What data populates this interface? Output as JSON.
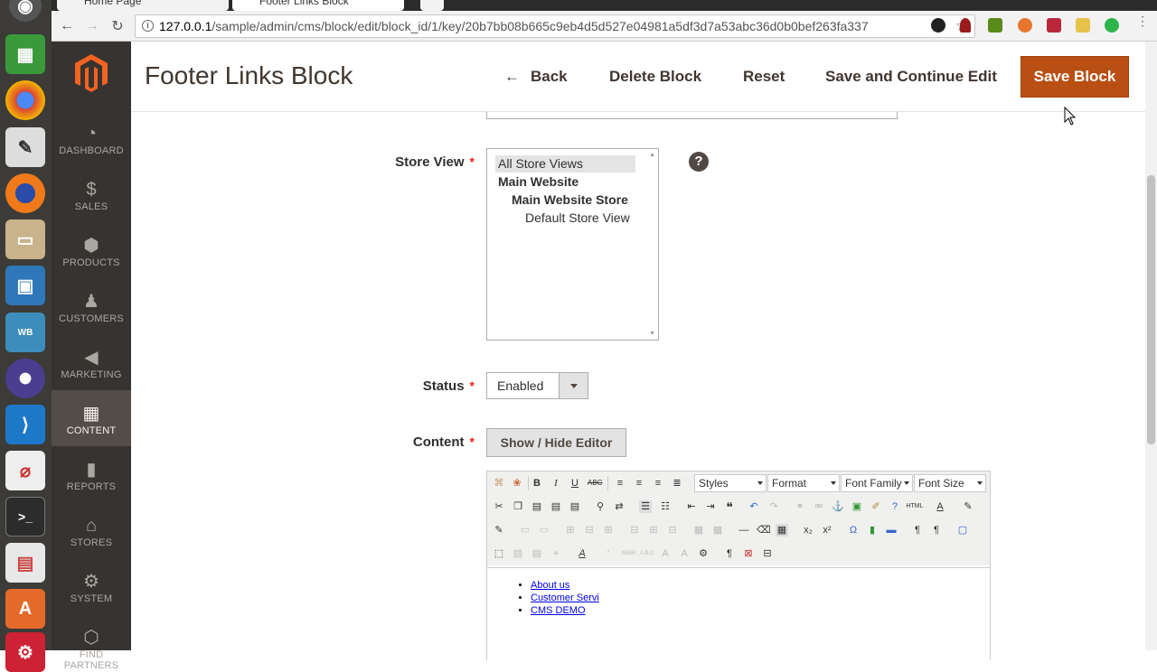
{
  "browser": {
    "tabs": [
      "Home Page",
      "Footer Links Block"
    ],
    "url_host": "127.0.0.1",
    "url_path": "/sample/admin/cms/block/edit/block_id/1/key/20b7bb08b665c9eb4d5d527e04981a5df3d7a53abc36d0b0bef263fa337",
    "nav": {
      "back": "←",
      "forward": "→",
      "reload": "↻",
      "star": "☆"
    }
  },
  "sidebar": {
    "items": [
      {
        "label": "DASHBOARD",
        "icon": "dashboard-icon"
      },
      {
        "label": "SALES",
        "icon": "dollar-icon"
      },
      {
        "label": "PRODUCTS",
        "icon": "cube-icon"
      },
      {
        "label": "CUSTOMERS",
        "icon": "person-icon"
      },
      {
        "label": "MARKETING",
        "icon": "megaphone-icon"
      },
      {
        "label": "CONTENT",
        "icon": "layout-icon",
        "active": true
      },
      {
        "label": "REPORTS",
        "icon": "bar-chart-icon"
      },
      {
        "label": "STORES",
        "icon": "store-icon"
      },
      {
        "label": "SYSTEM",
        "icon": "gear-icon"
      },
      {
        "label": "FIND PARTNERS",
        "icon": "box-icon"
      }
    ]
  },
  "header": {
    "title": "Footer Links Block",
    "back_arrow": "←",
    "back_label": "Back",
    "delete_label": "Delete Block",
    "reset_label": "Reset",
    "save_continue_label": "Save and Continue Edit",
    "save_label": "Save Block"
  },
  "form": {
    "store_view": {
      "label": "Store View",
      "required": "*",
      "options": [
        "All Store Views",
        "Main Website",
        "Main Website Store",
        "Default Store View"
      ],
      "help": "?"
    },
    "status": {
      "label": "Status",
      "required": "*",
      "value": "Enabled"
    },
    "content": {
      "label": "Content",
      "required": "*",
      "toggle_label": "Show / Hide Editor",
      "toolbar_dropdowns": [
        "Styles",
        "Format",
        "Font Family",
        "Font Size"
      ],
      "links": [
        "About us",
        "Customer Servi",
        "CMS DEMO"
      ]
    }
  },
  "colors": {
    "accent": "#b94f13",
    "sidebar_bg": "#373330",
    "sidebar_active": "#524d49",
    "required": "#e22626"
  }
}
